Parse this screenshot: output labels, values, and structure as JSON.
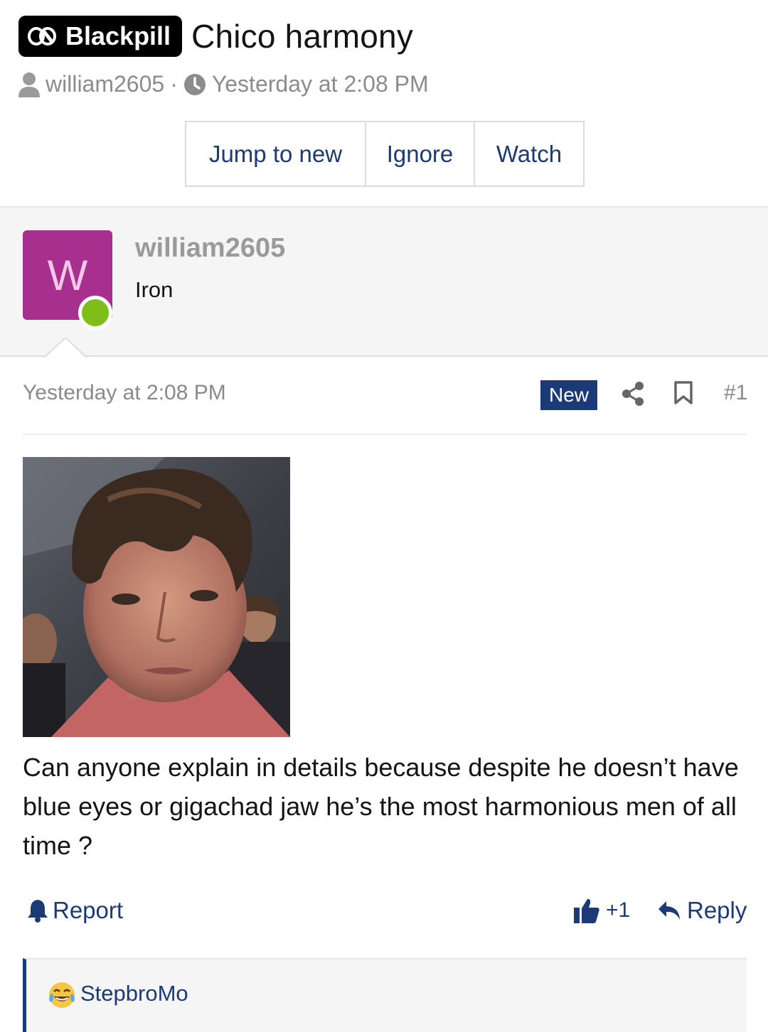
{
  "thread": {
    "prefix": "Blackpill",
    "title": "Chico harmony",
    "author": "william2605",
    "separator": "·",
    "timestamp": "Yesterday at 2:08 PM"
  },
  "actions": {
    "jump_to_new": "Jump to new",
    "ignore": "Ignore",
    "watch": "Watch"
  },
  "post": {
    "avatar_letter": "W",
    "username": "william2605",
    "user_title": "Iron",
    "date": "Yesterday at 2:08 PM",
    "new_badge": "New",
    "number": "#1",
    "body": "Can anyone explain in details because despite he doesn’t have blue eyes or gigachad jaw he’s the most harmonious men of all time ?",
    "report": "Report",
    "like_count": "+1",
    "reply": "Reply"
  },
  "reactions": {
    "emoji": "face-with-tears-of-joy-icon",
    "user": "StepbroMo"
  },
  "colors": {
    "link": "#1d3a78",
    "avatar_bg": "#a7308f",
    "online": "#7fbd19",
    "muted": "#8a8a8a"
  }
}
